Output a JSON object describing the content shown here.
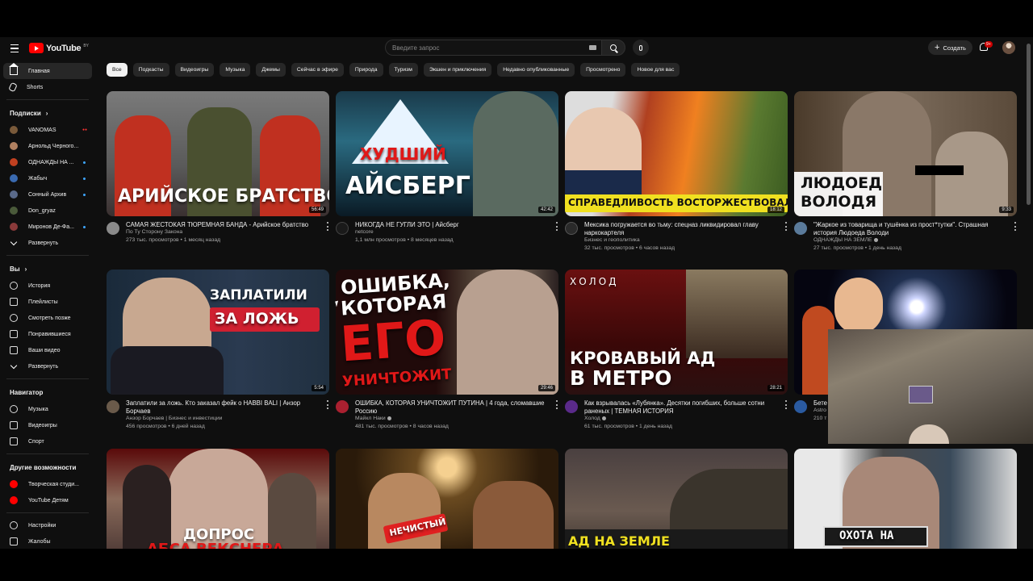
{
  "header": {
    "logo_text": "YouTube",
    "logo_country": "BY",
    "search_placeholder": "Введите запрос",
    "create_label": "Создать",
    "notifications_badge": "9+"
  },
  "sidebar": {
    "main": [
      {
        "label": "Главная",
        "icon": "home-icon",
        "active": true
      },
      {
        "label": "Shorts",
        "icon": "shorts-icon"
      }
    ],
    "subscriptions_header": "Подписки",
    "subscriptions": [
      {
        "label": "VANOMAS",
        "color": "#7a5a3a",
        "live": true
      },
      {
        "label": "Арнольд Черного...",
        "color": "#b08060",
        "dot": false
      },
      {
        "label": "ОДНАЖДЫ НА ...",
        "color": "#c04020",
        "dot": true
      },
      {
        "label": "Жабыч",
        "color": "#3a6ab0",
        "dot": true
      },
      {
        "label": "Сонный Архив",
        "color": "#5a6a8a",
        "dot": true
      },
      {
        "label": "Don_gryaz",
        "color": "#4a5a3a",
        "dot": false
      },
      {
        "label": "Миронов Де-Фа...",
        "color": "#8a3a3a",
        "dot": true
      }
    ],
    "subscriptions_expand": "Развернуть",
    "you_header": "Вы",
    "you": [
      {
        "label": "История",
        "icon": "history-icon"
      },
      {
        "label": "Плейлисты",
        "icon": "playlists-icon"
      },
      {
        "label": "Смотреть позже",
        "icon": "watch-later-icon"
      },
      {
        "label": "Понравившиеся",
        "icon": "like-icon"
      },
      {
        "label": "Ваши видео",
        "icon": "your-videos-icon"
      },
      {
        "label": "Развернуть",
        "icon": "chevron-down-icon"
      }
    ],
    "navigator_header": "Навигатор",
    "navigator": [
      {
        "label": "Музыка",
        "icon": "music-icon"
      },
      {
        "label": "Видеоигры",
        "icon": "gaming-icon"
      },
      {
        "label": "Спорт",
        "icon": "trophy-icon"
      }
    ],
    "more_header": "Другие возможности",
    "more": [
      {
        "label": "Творческая студи...",
        "icon": "studio-icon"
      },
      {
        "label": "YouTube Детям",
        "icon": "kids-icon"
      }
    ],
    "bottom": [
      {
        "label": "Настройки",
        "icon": "gear-icon"
      },
      {
        "label": "Жалобы",
        "icon": "flag-icon"
      }
    ]
  },
  "chips": [
    "Все",
    "Подкасты",
    "Видеоигры",
    "Музыка",
    "Джемы",
    "Сейчас в эфире",
    "Природа",
    "Туризм",
    "Экшен и приключения",
    "Недавно опубликованные",
    "Просмотрено",
    "Новое для вас"
  ],
  "videos": [
    {
      "title": "САМАЯ ЖЕСТОКАЯ ТЮРЕМНАЯ БАНДА - Арийское братство",
      "channel": "По Ту Сторону Закона",
      "stats": "273 тыс. просмотров • 1 месяц назад",
      "duration": "56:49",
      "thumb_text": "АРИЙСКОЕ БРАТСТВО",
      "avatar_color": "#8a8a8a",
      "verified": false
    },
    {
      "title": "НИКОГДА НЕ ГУГЛИ ЭТО | Айсберг",
      "channel": "netcore",
      "stats": "1,1 млн просмотров • 8 месяцев назад",
      "duration": "42:42",
      "thumb_text_1": "ХУДШИЙ",
      "thumb_text_2": "АЙСБЕРГ",
      "avatar_color": "#1a1a1a",
      "verified": false
    },
    {
      "title": "Мексика погружается во тьму: спецназ ликвидировал главу наркокартеля",
      "channel": "Бизнес и геополитика",
      "stats": "32 тыс. просмотров • 6 часов назад",
      "duration": "18:12",
      "thumb_text": "СПРАВЕДЛИВОСТЬ ВОСТОРЖЕСТВОВАЛА",
      "avatar_color": "#2a2a2a",
      "verified": false
    },
    {
      "title": "\"Жаркое из товарища и тушёнка из прост*тутки\". Страшная история Людоеда Володи",
      "channel": "ОДНАЖДЫ НА ЗЕМЛЕ",
      "stats": "27 тыс. просмотров • 1 день назад",
      "duration": "9:33",
      "thumb_text_1": "ЛЮДОЕД",
      "thumb_text_2": "ВОЛОДЯ",
      "avatar_color": "#5a7a9a",
      "verified": true
    },
    {
      "title": "Заплатили за ложь. Кто заказал фейк о HABBI BALI | Анзор Борчаев",
      "channel": "Анзор Борчаев | Бизнес и инвестиции",
      "stats": "456 просмотров • 6 дней назад",
      "duration": "5:54",
      "thumb_text_1": "ЗАПЛАТИЛИ",
      "thumb_text_2": "ЗА ЛОЖЬ",
      "avatar_color": "#6a5a4a",
      "verified": false
    },
    {
      "title": "ОШИБКА, КОТОРАЯ УНИЧТОЖИТ ПУТИНА | 4 года, сломавшие Россию",
      "channel": "Майкл Наки",
      "stats": "481 тыс. просмотров • 8 часов назад",
      "duration": "29:46",
      "thumb_text_1": "ОШИБКА,",
      "thumb_text_2": "КОТОРАЯ",
      "thumb_text_3": "ЕГО",
      "thumb_text_4": "УНИЧТОЖИТ",
      "avatar_color": "#aa2030",
      "verified": true
    },
    {
      "title": "Как взрывалась «Лубянка». Десятки погибших, больше сотни раненых | ТЕМНАЯ ИСТОРИЯ",
      "channel": "Холод",
      "stats": "61 тыс. просмотров • 1 день назад",
      "duration": "28:21",
      "thumb_text_1": "ХОЛОД",
      "thumb_text_2": "КРОВАВЫЙ АД",
      "thumb_text_3": "В МЕТРО",
      "avatar_color": "#5a2a8a",
      "verified": true
    },
    {
      "title": "Бете",
      "channel": "Astro",
      "stats": "210 т",
      "duration": "",
      "avatar_color": "#2a5aa0",
      "verified": false
    },
    {
      "thumb_text_1": "ДОПРОС",
      "thumb_text_2": "АБСА ВЕКСНЕРА"
    },
    {
      "thumb_text": "НЕЧИСТЫЙ"
    },
    {
      "thumb_text": "АД НА ЗЕМЛЕ"
    },
    {
      "thumb_text": "ОХОТА НА"
    }
  ]
}
